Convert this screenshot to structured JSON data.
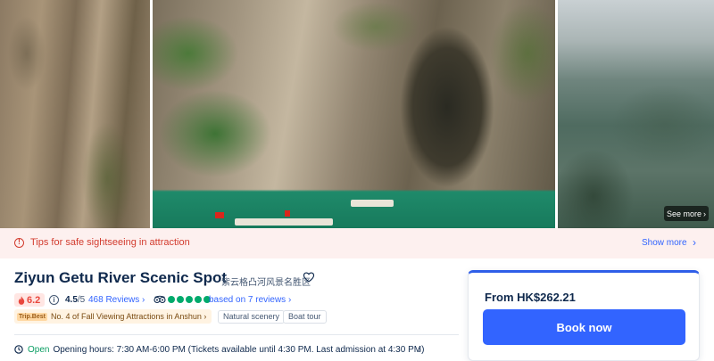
{
  "gallery": {
    "see_more_label": "See more"
  },
  "tips": {
    "text": "Tips for safe sightseeing in attraction",
    "show_more_label": "Show more"
  },
  "attraction": {
    "title": "Ziyun Getu River Scenic Spot",
    "title_local": "紫云格凸河风景名胜区",
    "heat_score": "6.2",
    "rating": "4.5",
    "rating_scale": "/5",
    "reviews_label": "468 Reviews",
    "tripadvisor_bubbles": 5,
    "tripadvisor_text": "based on 7 reviews",
    "ranking_badge": "Trip.Best",
    "ranking_text": "No. 4 of Fall Viewing Attractions in Anshun",
    "tags": [
      "Natural scenery",
      "Boat tour"
    ],
    "open_status": "Open",
    "hours_text": "Opening hours: 7:30 AM-6:00 PM (Tickets available until 4:30 PM. Last admission at 4:30 PM)"
  },
  "booking": {
    "price_text": "From  HK$262.21",
    "book_label": "Book now"
  },
  "colors": {
    "brand_blue": "#3264ff",
    "warning_red": "#d23b2e",
    "open_green": "#0a9e63",
    "tripadvisor_green": "#00aa6c"
  },
  "icons": [
    "alert-icon",
    "heart-icon",
    "flame-icon",
    "info-icon",
    "tripadvisor-icon",
    "clock-icon",
    "chevron-right-icon"
  ]
}
